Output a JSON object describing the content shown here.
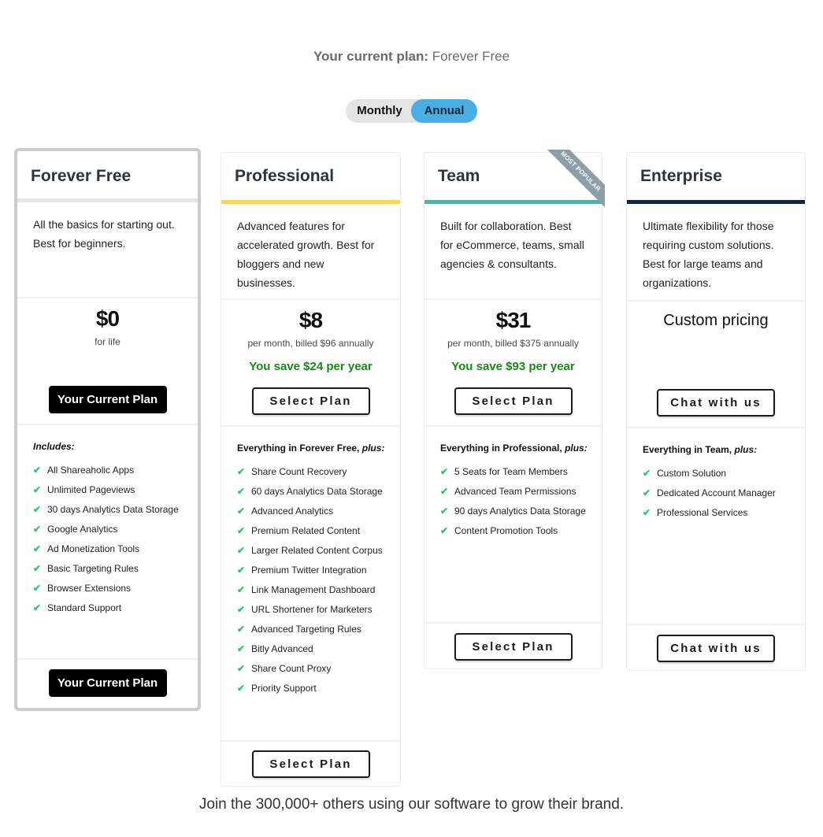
{
  "header": {
    "current_plan_label": "Your current plan:",
    "current_plan_value": "Forever Free"
  },
  "billing_toggle": {
    "options": [
      "Monthly",
      "Annual"
    ],
    "selected": "Annual"
  },
  "plans": [
    {
      "name": "Forever Free",
      "accent_color": "#e6e6e6",
      "description": "All the basics for starting out. Best for beginners.",
      "price": "$0",
      "price_note": "for life",
      "savings": "",
      "button_label": "Your Current Plan",
      "is_current": true,
      "features_heading": "Includes:",
      "features_heading_plus": "",
      "features": [
        "All Shareaholic Apps",
        "Unlimited Pageviews",
        "30 days Analytics Data Storage",
        "Google Analytics",
        "Ad Monetization Tools",
        "Basic Targeting Rules",
        "Browser Extensions",
        "Standard Support"
      ]
    },
    {
      "name": "Professional",
      "accent_color": "#fad660",
      "description": "Advanced features for accelerated growth. Best for bloggers and new businesses.",
      "price": "$8",
      "price_note": "per month, billed $96 annually",
      "savings": "You save $24 per year",
      "button_label": "Select Plan",
      "is_current": false,
      "features_heading": "Everything in Forever Free,",
      "features_heading_plus": "plus:",
      "features": [
        "Share Count Recovery",
        "60 days Analytics Data Storage",
        "Advanced Analytics",
        "Premium Related Content",
        "Larger Related Content Corpus",
        "Premium Twitter Integration",
        "Link Management Dashboard",
        "URL Shortener for Marketers",
        "Advanced Targeting Rules",
        "Bitly Advanced",
        "Share Count Proxy",
        "Priority Support"
      ]
    },
    {
      "name": "Team",
      "accent_color": "#54b0a6",
      "ribbon": "MOST POPULAR",
      "description": "Built for collaboration. Best for eCommerce, teams, small agencies & consultants.",
      "price": "$31",
      "price_note": "per month, billed $375 annually",
      "savings": "You save $93 per year",
      "button_label": "Select Plan",
      "is_current": false,
      "features_heading": "Everything in Professional,",
      "features_heading_plus": "plus:",
      "features": [
        "5 Seats for Team Members",
        "Advanced Team Permissions",
        "90 days Analytics Data Storage",
        "Content Promotion Tools"
      ]
    },
    {
      "name": "Enterprise",
      "accent_color": "#13263e",
      "description": "Ultimate flexibility for those requiring custom solutions. Best for large teams and organizations.",
      "price": "Custom pricing",
      "price_note": "",
      "savings": "",
      "button_label": "Chat with us",
      "is_current": false,
      "features_heading": "Everything in Team,",
      "features_heading_plus": "plus:",
      "features": [
        "Custom Solution",
        "Dedicated Account Manager",
        "Professional Services"
      ]
    }
  ],
  "footer": {
    "tagline": "Join the 300,000+ others using our software to grow their brand."
  },
  "icons": {
    "check": "✔"
  }
}
